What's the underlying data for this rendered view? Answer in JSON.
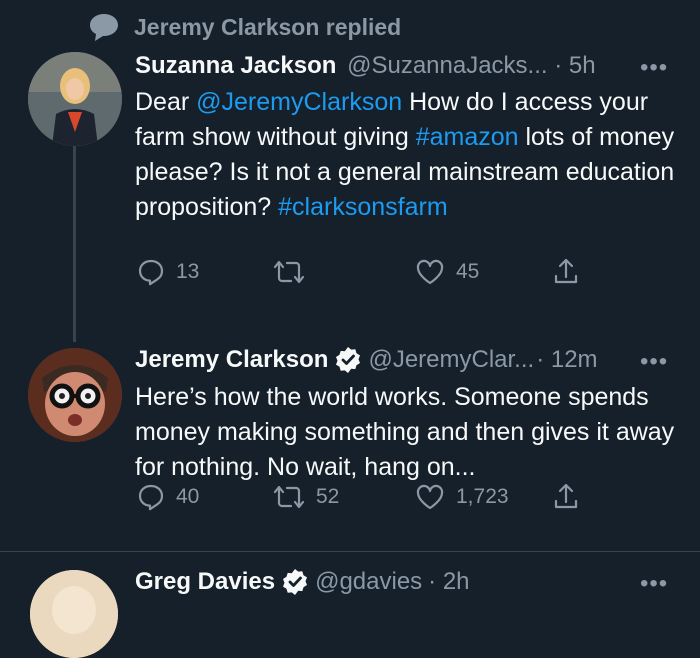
{
  "context": {
    "label": "Jeremy Clarkson replied",
    "icon": "speech-bubble-icon"
  },
  "tweets": [
    {
      "name": "Suzanna Jackson",
      "handle": "@SuzannaJacks...",
      "time": "· 5h",
      "verified": false,
      "text_parts": [
        {
          "t": "Dear ",
          "type": "text"
        },
        {
          "t": "@JeremyClarkson",
          "type": "link"
        },
        {
          "t": " How do I access your farm show without giving ",
          "type": "text"
        },
        {
          "t": "#amazon",
          "type": "link"
        },
        {
          "t": " lots of money please? Is it not a general mainstream education proposition? ",
          "type": "text"
        },
        {
          "t": "#clarksonsfarm",
          "type": "link"
        }
      ],
      "actions": {
        "reply": "13",
        "retweet": "",
        "like": "45"
      }
    },
    {
      "name": "Jeremy Clarkson",
      "handle": "@JeremyClar...",
      "time": "· 12m",
      "verified": true,
      "text_parts": [
        {
          "t": "Here’s how the world works. Someone spends money making something and then gives it away for nothing. No wait, hang on...",
          "type": "text"
        }
      ],
      "actions": {
        "reply": "40",
        "retweet": "52",
        "like": "1,723"
      }
    },
    {
      "name": "Greg Davies",
      "handle": "@gdavies",
      "time": "· 2h",
      "verified": true
    }
  ],
  "more_label": "•••",
  "colors": {
    "background": "#15202b",
    "text": "#f7f9f9",
    "muted": "#8b98a5",
    "link": "#1d9bf0",
    "divider": "#38444d"
  }
}
